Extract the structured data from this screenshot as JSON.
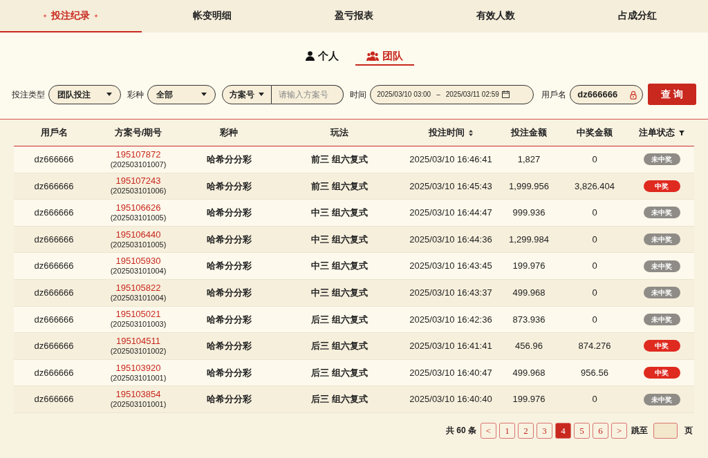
{
  "nav_tabs": [
    {
      "label": "投注纪录",
      "selected": true
    },
    {
      "label": "帐变明细",
      "selected": false
    },
    {
      "label": "盈亏报表",
      "selected": false
    },
    {
      "label": "有效人数",
      "selected": false
    },
    {
      "label": "占成分红",
      "selected": false
    }
  ],
  "scope_tabs": [
    {
      "label": "个人",
      "kind": "person",
      "selected": false
    },
    {
      "label": "团队",
      "kind": "team",
      "selected": true
    }
  ],
  "filters": {
    "bet_type": {
      "label": "投注类型",
      "value": "团队投注"
    },
    "lottery": {
      "label": "彩种",
      "value": "全部"
    },
    "plan": {
      "select": "方案号",
      "placeholder": "请输入方案号"
    },
    "time": {
      "label": "时间",
      "start": "2025/03/10 03:00",
      "separator": "–",
      "end": "2025/03/11 02:59"
    },
    "username": {
      "label": "用戶名",
      "value": "dz666666"
    },
    "query_button": "查 询"
  },
  "table": {
    "columns": [
      {
        "label": "用戶名",
        "kind": "plain"
      },
      {
        "label": "方案号/期号",
        "kind": "plain"
      },
      {
        "label": "彩种",
        "kind": "plain"
      },
      {
        "label": "玩法",
        "kind": "plain"
      },
      {
        "label": "投注时间",
        "kind": "sort"
      },
      {
        "label": "投注金额",
        "kind": "plain"
      },
      {
        "label": "中奖金额",
        "kind": "plain"
      },
      {
        "label": "注单状态",
        "kind": "filter"
      }
    ],
    "rows": [
      {
        "user": "dz666666",
        "plan": "195107872",
        "issue": "(202503101007)",
        "lottery": "哈希分分彩",
        "play": "前三 组六复式",
        "time": "2025/03/10 16:46:41",
        "bet": "1,827",
        "win": "0",
        "status": "未中奖",
        "won": false
      },
      {
        "user": "dz666666",
        "plan": "195107243",
        "issue": "(202503101006)",
        "lottery": "哈希分分彩",
        "play": "前三 组六复式",
        "time": "2025/03/10 16:45:43",
        "bet": "1,999.956",
        "win": "3,826.404",
        "status": "中奖",
        "won": true
      },
      {
        "user": "dz666666",
        "plan": "195106626",
        "issue": "(202503101005)",
        "lottery": "哈希分分彩",
        "play": "中三 组六复式",
        "time": "2025/03/10 16:44:47",
        "bet": "999.936",
        "win": "0",
        "status": "未中奖",
        "won": false
      },
      {
        "user": "dz666666",
        "plan": "195106440",
        "issue": "(202503101005)",
        "lottery": "哈希分分彩",
        "play": "中三 组六复式",
        "time": "2025/03/10 16:44:36",
        "bet": "1,299.984",
        "win": "0",
        "status": "未中奖",
        "won": false
      },
      {
        "user": "dz666666",
        "plan": "195105930",
        "issue": "(202503101004)",
        "lottery": "哈希分分彩",
        "play": "中三 组六复式",
        "time": "2025/03/10 16:43:45",
        "bet": "199.976",
        "win": "0",
        "status": "未中奖",
        "won": false
      },
      {
        "user": "dz666666",
        "plan": "195105822",
        "issue": "(202503101004)",
        "lottery": "哈希分分彩",
        "play": "中三 组六复式",
        "time": "2025/03/10 16:43:37",
        "bet": "499.968",
        "win": "0",
        "status": "未中奖",
        "won": false
      },
      {
        "user": "dz666666",
        "plan": "195105021",
        "issue": "(202503101003)",
        "lottery": "哈希分分彩",
        "play": "后三 组六复式",
        "time": "2025/03/10 16:42:36",
        "bet": "873.936",
        "win": "0",
        "status": "未中奖",
        "won": false
      },
      {
        "user": "dz666666",
        "plan": "195104511",
        "issue": "(202503101002)",
        "lottery": "哈希分分彩",
        "play": "后三 组六复式",
        "time": "2025/03/10 16:41:41",
        "bet": "456.96",
        "win": "874.276",
        "status": "中奖",
        "won": true
      },
      {
        "user": "dz666666",
        "plan": "195103920",
        "issue": "(202503101001)",
        "lottery": "哈希分分彩",
        "play": "后三 组六复式",
        "time": "2025/03/10 16:40:47",
        "bet": "499.968",
        "win": "956.56",
        "status": "中奖",
        "won": true
      },
      {
        "user": "dz666666",
        "plan": "195103854",
        "issue": "(202503101001)",
        "lottery": "哈希分分彩",
        "play": "后三 组六复式",
        "time": "2025/03/10 16:40:40",
        "bet": "199.976",
        "win": "0",
        "status": "未中奖",
        "won": false
      }
    ]
  },
  "pagination": {
    "total": "共 60 条",
    "prev": "<",
    "pages": [
      {
        "label": "1",
        "selected": false
      },
      {
        "label": "2",
        "selected": false
      },
      {
        "label": "3",
        "selected": false
      },
      {
        "label": "4",
        "selected": true
      },
      {
        "label": "5",
        "selected": false
      },
      {
        "label": "6",
        "selected": false
      }
    ],
    "next": ">",
    "jump_label": "跳至",
    "page_suffix": "页"
  }
}
